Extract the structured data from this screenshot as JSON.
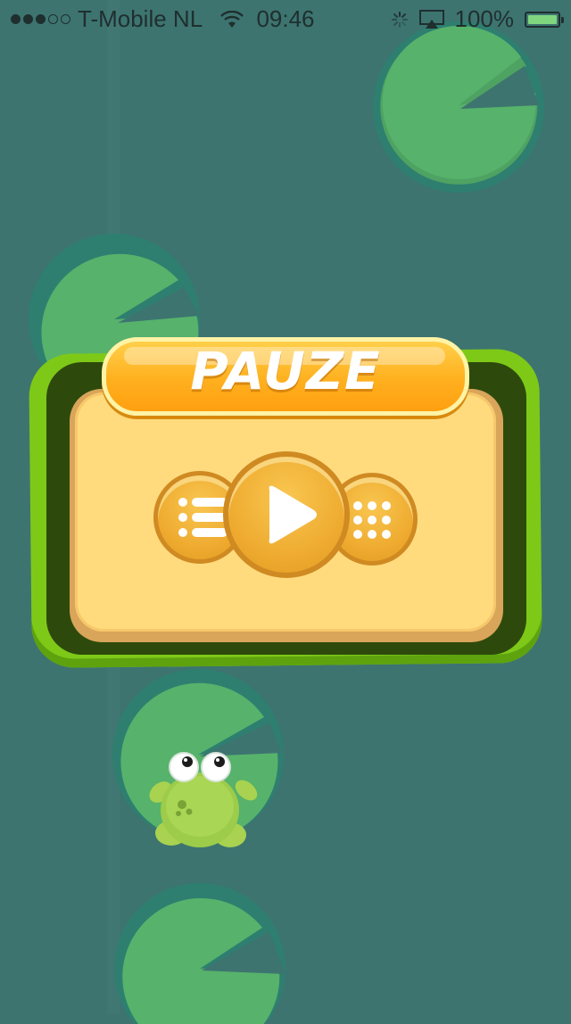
{
  "status_bar": {
    "carrier": "T-Mobile NL",
    "time": "09:46",
    "battery": "100%",
    "signal_bars_filled": 3,
    "signal_bars_total": 5,
    "battery_level": 1.0,
    "icons": [
      "signal-dots-icon",
      "wifi-icon",
      "activity-spinner-icon",
      "airplay-icon",
      "battery-icon"
    ]
  },
  "dialog": {
    "title": "PAUZE",
    "buttons": [
      {
        "name": "menu-list-button",
        "icon": "list-icon"
      },
      {
        "name": "play-button",
        "icon": "play-icon"
      },
      {
        "name": "levels-button",
        "icon": "grid-dots-icon"
      }
    ]
  },
  "colors": {
    "water": "#3d7470",
    "pad": "#56b06a",
    "pad_ring": "#2e7f70",
    "dialog_green": "#7ec918",
    "dialog_dark": "#2d4a0c",
    "panel": "#ffdb7e",
    "title_orange": "#ffb01f",
    "button_orange": "#eeaa2f",
    "frog": "#9ccc4a"
  }
}
